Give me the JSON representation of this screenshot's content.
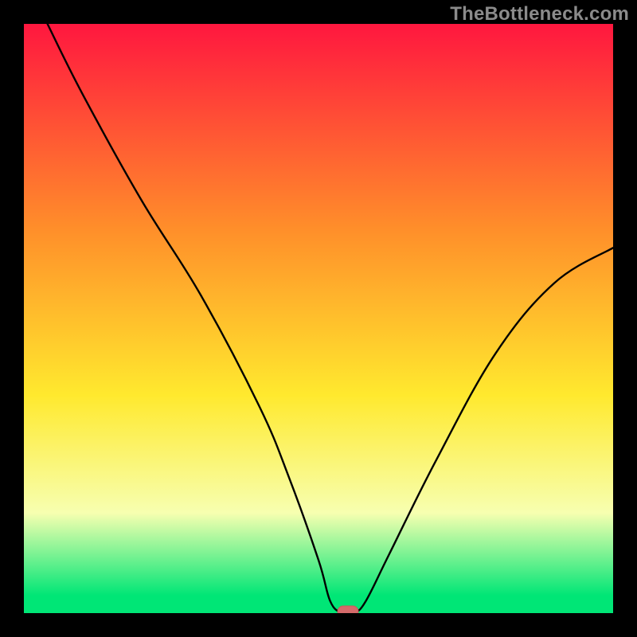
{
  "watermark": "TheBottleneck.com",
  "colors": {
    "black": "#000000",
    "watermark": "#8b8b8b",
    "curve": "#000000",
    "marker_fill": "#d46a6a",
    "marker_stroke": "#c95a5a",
    "gradient_top": "#ff173f",
    "gradient_mid1": "#ff8f2a",
    "gradient_mid2": "#ffe92e",
    "gradient_near_bottom": "#f7ffb0",
    "gradient_bottom": "#00e676"
  },
  "chart_data": {
    "type": "line",
    "title": "",
    "xlabel": "",
    "ylabel": "",
    "xlim": [
      0,
      100
    ],
    "ylim": [
      0,
      100
    ],
    "grid": false,
    "legend": false,
    "series": [
      {
        "name": "bottleneck-curve",
        "x": [
          4,
          10,
          20,
          30,
          40,
          45,
          50,
          52,
          54,
          56,
          58,
          62,
          70,
          80,
          90,
          100
        ],
        "y": [
          100,
          88,
          70,
          54,
          35,
          23,
          9,
          2,
          0,
          0,
          2,
          10,
          26,
          44,
          56,
          62
        ]
      }
    ],
    "marker": {
      "x": 55,
      "y": 0
    },
    "background_gradient_stops": [
      {
        "pos": 0.0,
        "color": "#ff173f"
      },
      {
        "pos": 0.35,
        "color": "#ff8f2a"
      },
      {
        "pos": 0.63,
        "color": "#ffe92e"
      },
      {
        "pos": 0.83,
        "color": "#f7ffb0"
      },
      {
        "pos": 0.97,
        "color": "#00e676"
      }
    ]
  }
}
